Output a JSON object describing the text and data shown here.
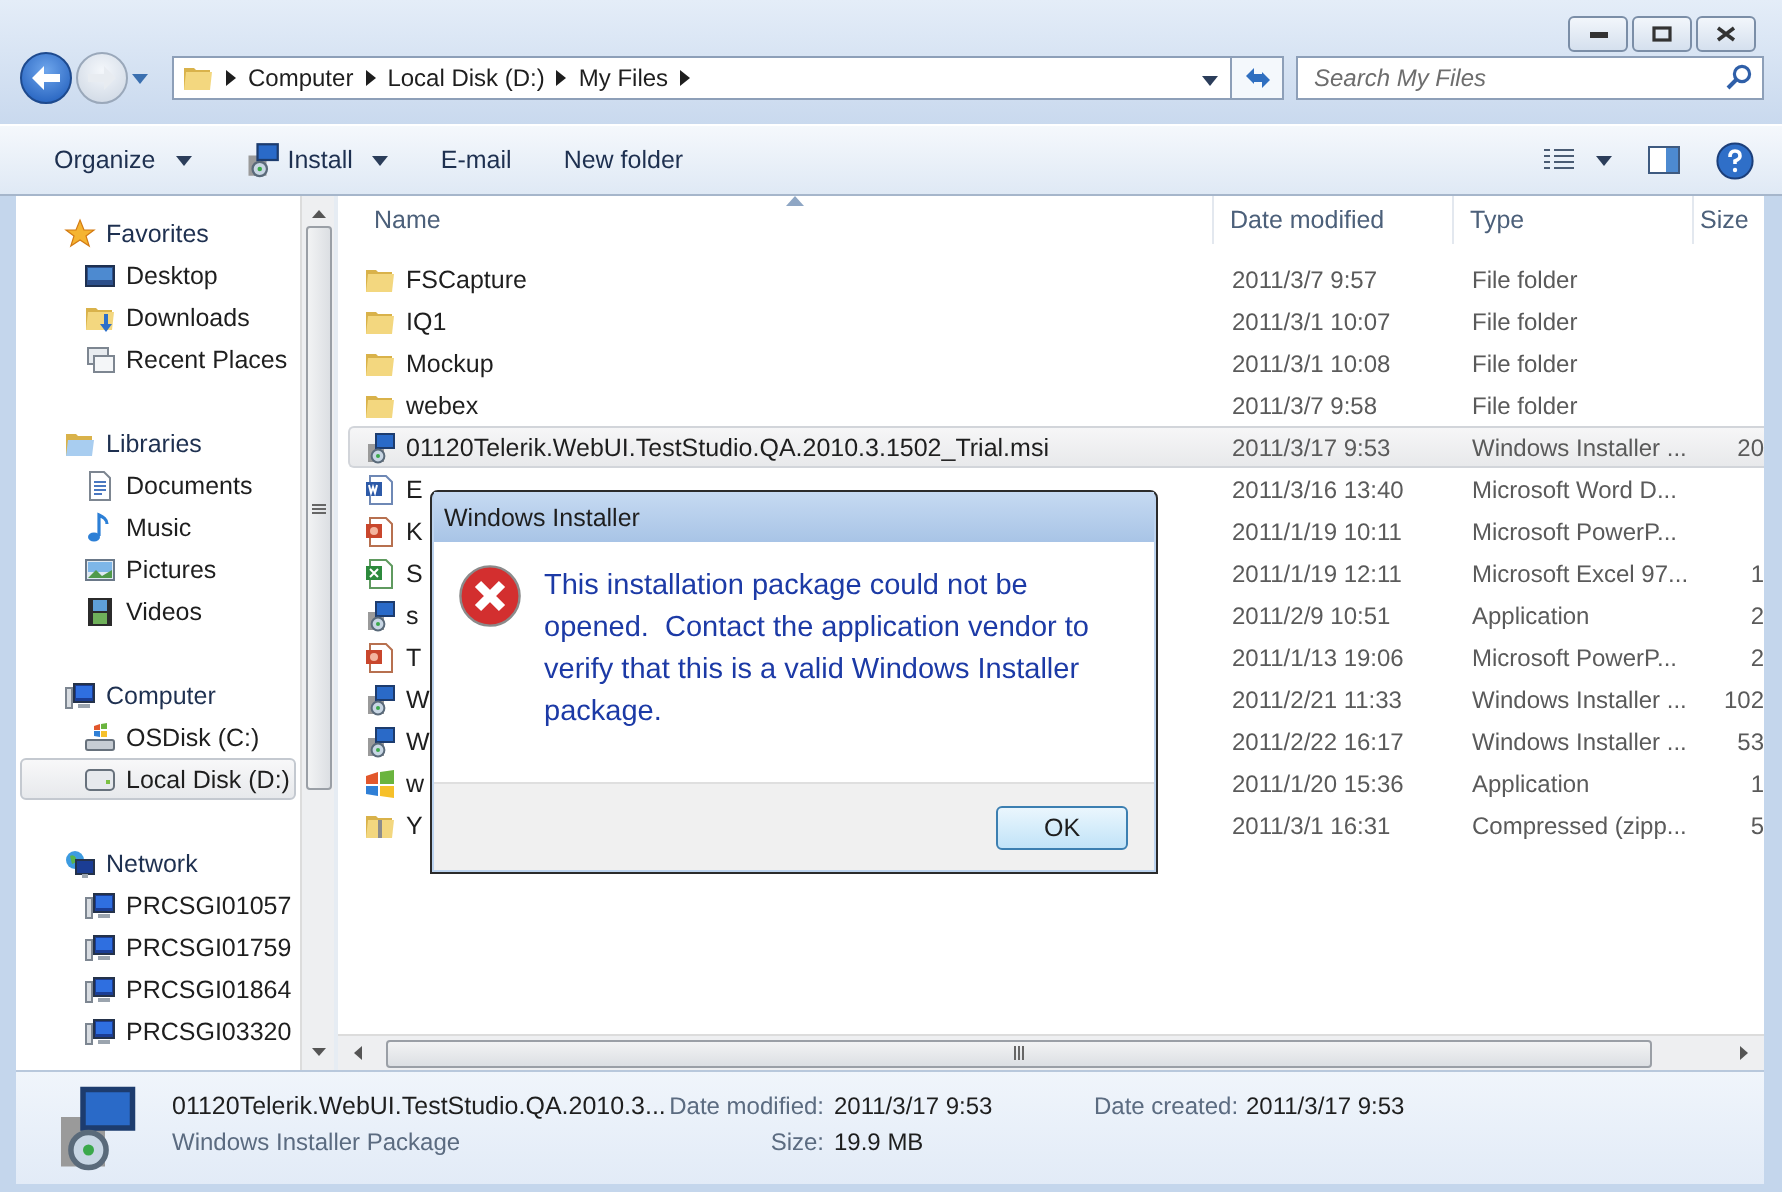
{
  "address": {
    "breadcrumbs": [
      "Computer",
      "Local Disk (D:)",
      "My Files"
    ]
  },
  "search": {
    "placeholder": "Search My Files"
  },
  "toolbar": {
    "items": [
      {
        "kind": "plain",
        "label": "Organize",
        "dropdown": true
      },
      {
        "kind": "installer",
        "label": "Install",
        "dropdown": true
      },
      {
        "kind": "plain",
        "label": "E-mail",
        "dropdown": false
      },
      {
        "kind": "plain",
        "label": "New folder",
        "dropdown": false
      }
    ]
  },
  "sidebar": {
    "groups": [
      {
        "label": "Favorites",
        "kind": "star",
        "selected": false,
        "children": [
          {
            "label": "Desktop",
            "kind": "desktop",
            "selected": false
          },
          {
            "label": "Downloads",
            "kind": "downloads",
            "selected": false
          },
          {
            "label": "Recent Places",
            "kind": "recent",
            "selected": false
          }
        ]
      },
      {
        "label": "Libraries",
        "kind": "library",
        "selected": false,
        "children": [
          {
            "label": "Documents",
            "kind": "document",
            "selected": false
          },
          {
            "label": "Music",
            "kind": "music",
            "selected": false
          },
          {
            "label": "Pictures",
            "kind": "pictures",
            "selected": false
          },
          {
            "label": "Videos",
            "kind": "videos",
            "selected": false
          }
        ]
      },
      {
        "label": "Computer",
        "kind": "computer",
        "selected": false,
        "children": [
          {
            "label": "OSDisk (C:)",
            "kind": "system-drive",
            "selected": false
          },
          {
            "label": "Local Disk (D:)",
            "kind": "drive",
            "selected": true
          }
        ]
      },
      {
        "label": "Network",
        "kind": "network",
        "selected": false,
        "children": [
          {
            "label": "PRCSGI01057",
            "kind": "computer",
            "selected": false
          },
          {
            "label": "PRCSGI01759",
            "kind": "computer",
            "selected": false
          },
          {
            "label": "PRCSGI01864",
            "kind": "computer",
            "selected": false
          },
          {
            "label": "PRCSGI03320",
            "kind": "computer",
            "selected": false
          }
        ]
      }
    ]
  },
  "files": {
    "columns": [
      {
        "label": "Name",
        "sorted": true
      },
      {
        "label": "Date modified",
        "sorted": false
      },
      {
        "label": "Type",
        "sorted": false
      },
      {
        "label": "Size",
        "sorted": false
      }
    ],
    "rows": [
      {
        "kind": "folder",
        "name": "FSCapture",
        "date": "2011/3/7 9:57",
        "type": "File folder",
        "selected": false
      },
      {
        "kind": "folder",
        "name": "IQ1",
        "date": "2011/3/1 10:07",
        "type": "File folder",
        "selected": false
      },
      {
        "kind": "folder",
        "name": "Mockup",
        "date": "2011/3/1 10:08",
        "type": "File folder",
        "selected": false
      },
      {
        "kind": "folder",
        "name": "webex",
        "date": "2011/3/7 9:58",
        "type": "File folder",
        "selected": false
      },
      {
        "kind": "installer",
        "name": "01120Telerik.WebUI.TestStudio.QA.2010.3.1502_Trial.msi",
        "date": "2011/3/17 9:53",
        "type": "Windows Installer ...",
        "size": "20",
        "selected": true
      },
      {
        "kind": "word",
        "name": "E",
        "date": "2011/3/16 13:40",
        "type": "Microsoft Word D...",
        "selected": false
      },
      {
        "kind": "powerpoint",
        "name": "K",
        "date": "2011/1/19 10:11",
        "type": "Microsoft PowerP...",
        "selected": false
      },
      {
        "kind": "excel",
        "name": "S",
        "date": "2011/1/19 12:11",
        "type": "Microsoft Excel 97...",
        "size": "1",
        "selected": false
      },
      {
        "kind": "installer",
        "name": "s",
        "date": "2011/2/9 10:51",
        "type": "Application",
        "size": "2",
        "selected": false
      },
      {
        "kind": "powerpoint",
        "name": "T",
        "date": "2011/1/13 19:06",
        "type": "Microsoft PowerP...",
        "size": "2",
        "selected": false
      },
      {
        "kind": "installer",
        "name": "W",
        "date": "2011/2/21 11:33",
        "type": "Windows Installer ...",
        "size": "102",
        "selected": false
      },
      {
        "kind": "installer",
        "name": "W",
        "date": "2011/2/22 16:17",
        "type": "Windows Installer ...",
        "size": "53",
        "selected": false
      },
      {
        "kind": "application",
        "name": "w",
        "date": "2011/1/20 15:36",
        "type": "Application",
        "size": "1",
        "selected": false
      },
      {
        "kind": "zip",
        "name": "Y",
        "date": "2011/3/1 16:31",
        "type": "Compressed (zipp...",
        "size": "5",
        "selected": false
      }
    ]
  },
  "details": {
    "name": "01120Telerik.WebUI.TestStudio.QA.2010.3...",
    "type": "Windows Installer Package",
    "fields": [
      {
        "label": "Date modified:",
        "value": "2011/3/17 9:53"
      },
      {
        "label": "Size:",
        "value": "19.9 MB"
      },
      {
        "label": "Date created:",
        "value": "2011/3/17 9:53"
      }
    ]
  },
  "dialog": {
    "title": "Windows Installer",
    "message": "This installation package could not be opened.  Contact the application vendor to verify that this is a valid Windows Installer package.",
    "buttons": [
      "OK"
    ]
  }
}
